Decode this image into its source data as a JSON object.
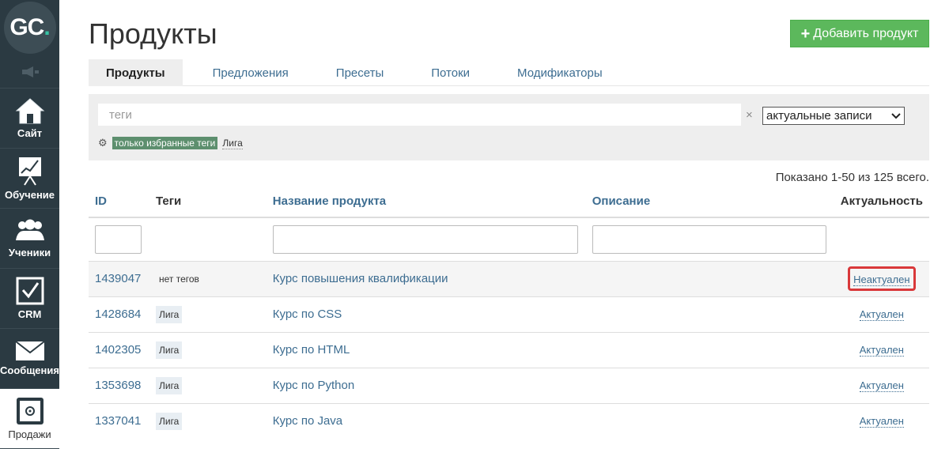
{
  "logo": {
    "text": "GC",
    "dot": "."
  },
  "sidebar": {
    "items": [
      {
        "label": "Сайт",
        "icon": "house-icon"
      },
      {
        "label": "Обучение",
        "icon": "chart-easel-icon"
      },
      {
        "label": "Ученики",
        "icon": "users-icon"
      },
      {
        "label": "CRM",
        "icon": "checkbox-icon"
      },
      {
        "label": "Сообщения",
        "icon": "envelope-icon"
      },
      {
        "label": "Продажи",
        "icon": "safe-icon"
      }
    ]
  },
  "header": {
    "title": "Продукты",
    "add_button": "Добавить продукт"
  },
  "tabs": [
    "Продукты",
    "Предложения",
    "Пресеты",
    "Потоки",
    "Модификаторы"
  ],
  "filter": {
    "tags_placeholder": "теги",
    "clear": "×",
    "select_value": "актуальные записи",
    "fav_tags": "только избранные теги",
    "tag_liga": "Лига"
  },
  "summary": "Показано 1-50 из 125 всего.",
  "table": {
    "columns": [
      "ID",
      "Теги",
      "Название продукта",
      "Описание",
      "Актуальность"
    ],
    "rows": [
      {
        "id": "1439047",
        "tag": "нет тегов",
        "name": "Курс повышения квалификации",
        "status": "Неактуален"
      },
      {
        "id": "1428684",
        "tag": "Лига",
        "name": "Курс по CSS",
        "status": "Актуален"
      },
      {
        "id": "1402305",
        "tag": "Лига",
        "name": "Курс по HTML",
        "status": "Актуален"
      },
      {
        "id": "1353698",
        "tag": "Лига",
        "name": "Курс по Python",
        "status": "Актуален"
      },
      {
        "id": "1337041",
        "tag": "Лига",
        "name": "Курс по Java",
        "status": "Актуален"
      }
    ]
  },
  "colors": {
    "sidebar": "#2b3a42",
    "accent_green": "#5cb85c",
    "link": "#3d6d91",
    "highlight": "#d9383a"
  }
}
